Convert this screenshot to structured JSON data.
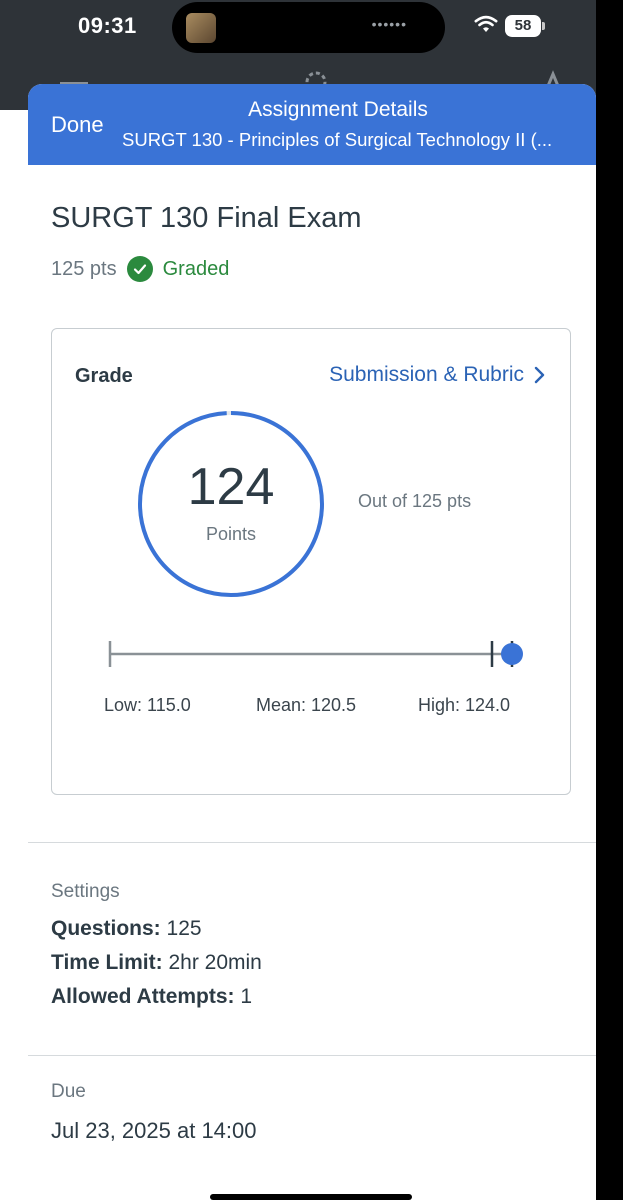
{
  "status_bar": {
    "time": "09:31",
    "battery": "58"
  },
  "header": {
    "done_label": "Done",
    "title": "Assignment Details",
    "subtitle": "SURGT 130 - Principles of Surgical Technology II (..."
  },
  "assignment": {
    "title": "SURGT 130 Final Exam",
    "points": "125 pts",
    "status": "Graded"
  },
  "grade": {
    "label": "Grade",
    "link_label": "Submission & Rubric",
    "score": "124",
    "score_label": "Points",
    "out_of": "Out of 125 pts",
    "score_fraction": 0.992,
    "low": "Low: 115.0",
    "mean": "Mean: 120.5",
    "high": "High: 124.0"
  },
  "stats": {
    "low": 115.0,
    "mean": 120.5,
    "high": 124.0,
    "score": 124
  },
  "settings": {
    "section_label": "Settings",
    "items": [
      {
        "key": "Questions:",
        "value": "125"
      },
      {
        "key": "Time Limit:",
        "value": "2hr 20min"
      },
      {
        "key": "Allowed Attempts:",
        "value": "1"
      }
    ]
  },
  "due": {
    "section_label": "Due",
    "value": "Jul 23, 2025 at 14:00"
  },
  "colors": {
    "brand": "#3a73d6",
    "success": "#2b8a3e",
    "link": "#2b63b5"
  }
}
